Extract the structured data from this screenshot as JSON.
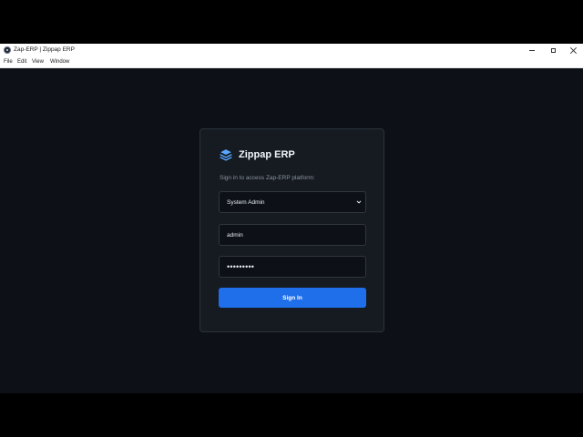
{
  "window": {
    "title": "Zap-ERP | Zippap ERP"
  },
  "menu": {
    "items": [
      "File",
      "Edit",
      "View",
      "Window"
    ]
  },
  "login": {
    "brand_name": "Zippap ERP",
    "subtitle": "Sign in to access Zap-ERP platform:",
    "role_select": "System Admin",
    "username": "admin",
    "password_mask": "•••••••••",
    "signin_label": "Sign In"
  },
  "colors": {
    "background": "#0d1117",
    "card": "#161b22",
    "accent": "#1f6feb",
    "brand_icon": "#58a6ff"
  },
  "icons": {
    "brand": "layers-icon",
    "select": "chevron-down-icon"
  }
}
